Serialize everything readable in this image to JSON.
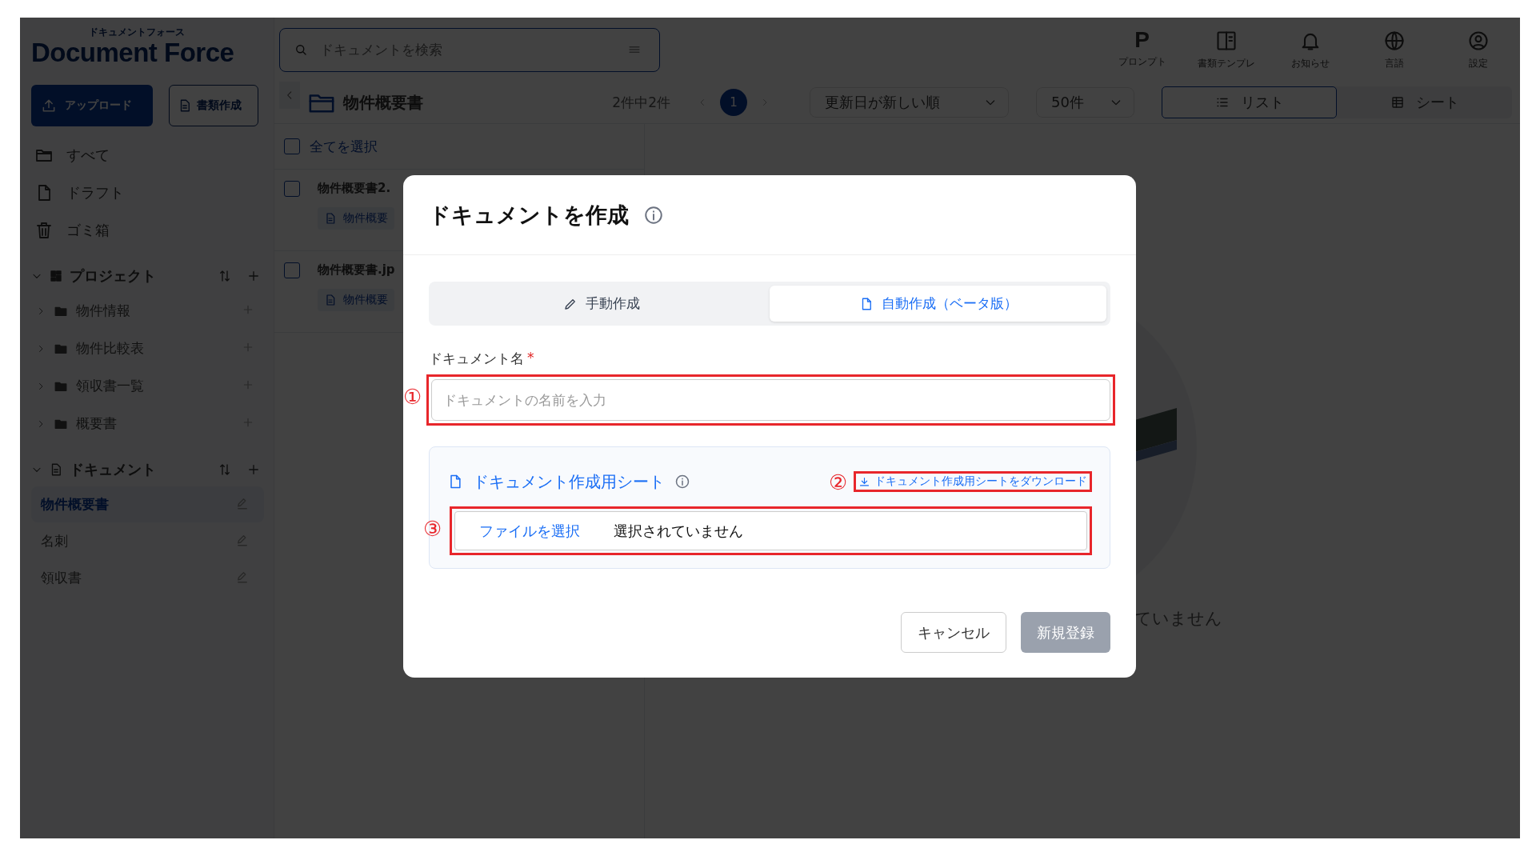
{
  "logo": {
    "subtitle": "ドキュメントフォース",
    "title": "Document Force"
  },
  "search": {
    "placeholder": "ドキュメントを検索"
  },
  "header_actions": [
    {
      "label": "プロンプト",
      "kind": "letter",
      "glyph": "P"
    },
    {
      "label": "書類テンプレ",
      "kind": "template"
    },
    {
      "label": "お知らせ",
      "kind": "bell"
    },
    {
      "label": "言語",
      "kind": "globe"
    },
    {
      "label": "設定",
      "kind": "user"
    }
  ],
  "sidebar": {
    "upload_button": "アップロード",
    "create_button": "書類作成",
    "nav": [
      {
        "label": "すべて",
        "kind": "folder"
      },
      {
        "label": "ドラフト",
        "kind": "file"
      },
      {
        "label": "ゴミ箱",
        "kind": "trash"
      }
    ],
    "sections": [
      {
        "title": "プロジェクト",
        "kind": "grid",
        "expanded": true,
        "items": [
          {
            "label": "物件情報",
            "expanded": false
          },
          {
            "label": "物件比較表",
            "expanded": false
          },
          {
            "label": "領収書一覧",
            "expanded": false
          },
          {
            "label": "概要書",
            "expanded": false
          }
        ]
      },
      {
        "title": "ドキュメント",
        "kind": "document",
        "expanded": true,
        "items": [
          {
            "label": "物件概要書",
            "selected": true
          },
          {
            "label": "名刺",
            "selected": false
          },
          {
            "label": "領収書",
            "selected": false
          }
        ]
      }
    ]
  },
  "toolbar": {
    "title": "物件概要書",
    "count": "2件中2件",
    "pages": [
      {
        "label": "1",
        "selected": true
      }
    ],
    "sort": "更新日が新しい順",
    "per_page": "50件",
    "views": [
      {
        "label": "リスト",
        "kind": "list",
        "selected": true
      },
      {
        "label": "シート",
        "kind": "sheet",
        "selected": false
      }
    ]
  },
  "list": {
    "select_all": {
      "label": "全てを選択",
      "checked": false
    },
    "rows": [
      {
        "name": "物件概要書2.",
        "checked": false,
        "tag": "物件概要"
      },
      {
        "name": "物件概要書.jp",
        "checked": false,
        "tag": "物件概要"
      }
    ]
  },
  "empty_state": {
    "message": "ていません"
  },
  "dialog": {
    "title": "ドキュメントを作成",
    "tabs": [
      {
        "label": "手動作成",
        "kind": "pencil",
        "selected": false
      },
      {
        "label": "自動作成（ベータ版）",
        "kind": "file",
        "selected": true
      }
    ],
    "name_field": {
      "label": "ドキュメント名",
      "required_mark": "*",
      "placeholder": "ドキュメントの名前を入力",
      "annotation": "①"
    },
    "sheet": {
      "title": "ドキュメント作成用シート",
      "download_link": "ドキュメント作成用シートをダウンロード",
      "download_annotation": "②",
      "file_button": "ファイルを選択",
      "file_status": "選択されていません",
      "file_annotation": "③"
    },
    "buttons": [
      {
        "label": "キャンセル",
        "kind": "cancel",
        "disabled": false
      },
      {
        "label": "新規登録",
        "kind": "submit",
        "disabled": true
      }
    ]
  }
}
